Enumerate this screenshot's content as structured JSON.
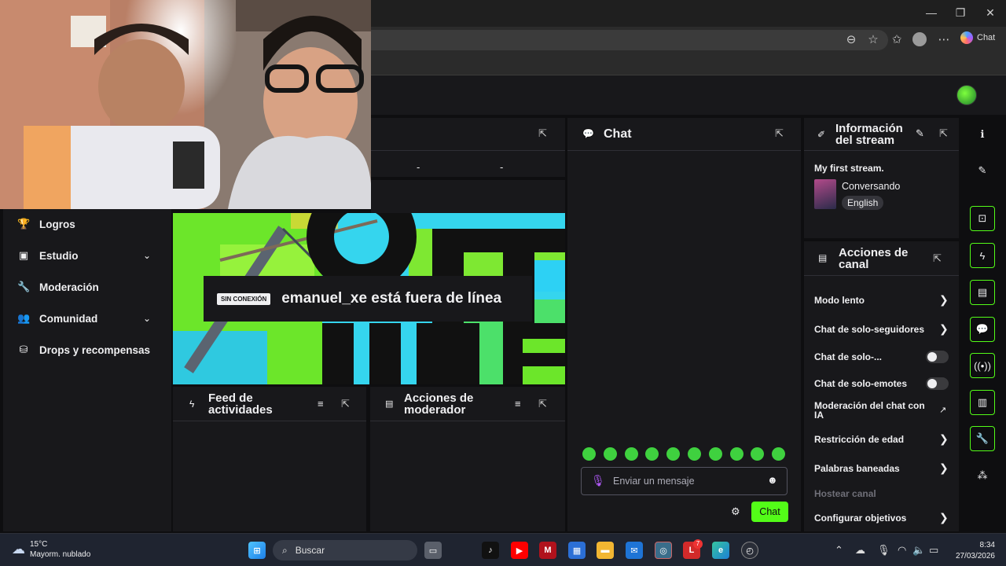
{
  "browser": {
    "chat_label": "Chat",
    "title_controls": {
      "minimize": "—",
      "maximize": "❐",
      "close": "✕"
    }
  },
  "dashboard": {
    "stats_placeholders": [
      "-",
      "-"
    ],
    "nav": {
      "items": [
        {
          "label": "Logros",
          "icon": "trophy-icon",
          "expandable": false
        },
        {
          "label": "Estudio",
          "icon": "studio-icon",
          "expandable": true
        },
        {
          "label": "Moderación",
          "icon": "wrench-icon",
          "expandable": false
        },
        {
          "label": "Comunidad",
          "icon": "community-icon",
          "expandable": true
        },
        {
          "label": "Drops y recompensas",
          "icon": "drops-icon",
          "expandable": false
        }
      ]
    },
    "offline": {
      "badge": "SIN CONEXIÓN",
      "message": "emanuel_xe está fuera de línea",
      "background_text": "OFF LINE"
    },
    "feed": {
      "title": "Feed de actividades"
    },
    "mod_actions": {
      "title": "Acciones de moderador"
    },
    "chat": {
      "title": "Chat",
      "input_placeholder": "Enviar un mensaje",
      "send_label": "Chat",
      "emotes": [
        "emote-1",
        "emote-2",
        "emote-3",
        "emote-4",
        "emote-5",
        "emote-6",
        "emote-7",
        "emote-8",
        "emote-9",
        "emote-10"
      ]
    },
    "stream_info": {
      "title": "Información del stream",
      "stream_title": "My first stream.",
      "category": "Conversando",
      "language_tag": "English"
    },
    "channel_actions": {
      "title": "Acciones de canal",
      "items": [
        {
          "label": "Modo lento",
          "control": "arrow"
        },
        {
          "label": "Chat de solo-seguidores",
          "control": "arrow"
        },
        {
          "label": "Chat de solo-...",
          "control": "toggle",
          "enabled": false
        },
        {
          "label": "Chat de solo-emotes",
          "control": "toggle",
          "enabled": false
        },
        {
          "label": "Moderación del chat con IA",
          "control": "external"
        },
        {
          "label": "Restricción de edad",
          "control": "arrow"
        },
        {
          "label": "Palabras baneadas",
          "control": "arrow"
        },
        {
          "label": "Hostear canal",
          "control": "disabled"
        },
        {
          "label": "Configurar objetivos",
          "control": "arrow"
        }
      ]
    }
  },
  "taskbar": {
    "weather_temp": "15°C",
    "weather_desc": "Mayorm. nublado",
    "search_placeholder": "Buscar",
    "time": "8:34",
    "date": "27/03/2026",
    "notification_badge": "7"
  },
  "colors": {
    "accent": "#53fc18",
    "panel": "#18181b",
    "background": "#0e0e10",
    "text": "#efeff1"
  }
}
